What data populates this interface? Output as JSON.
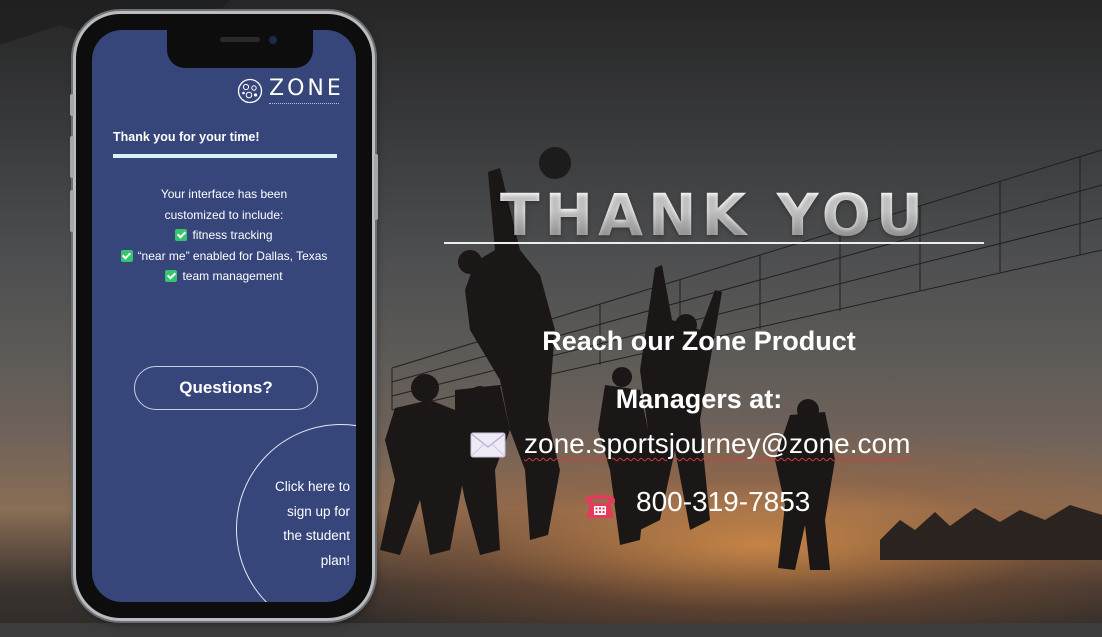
{
  "phone_screen": {
    "logo": {
      "text": "ZONE",
      "subtext": "SPORTS JOURNEY"
    },
    "thanks_heading": "Thank you for your time!",
    "intro_line1": "Your interface has been",
    "intro_line2": "customized to include:",
    "features": [
      "fitness tracking",
      "“near me” enabled for Dallas, Texas",
      "team management"
    ],
    "questions_button": "Questions?",
    "signup_cta": [
      "Click here to",
      "sign up for",
      "the student",
      "plan!"
    ]
  },
  "slide": {
    "title": "THANK YOU",
    "reach_line1": "Reach our Zone Product",
    "reach_line2": "Managers at:",
    "email": "zone.sportsjourney@zone.com",
    "phone": "800-319-7853"
  },
  "icons": {
    "check": "checkbox-checked-icon",
    "envelope": "envelope-icon",
    "telephone": "telephone-icon"
  },
  "colors": {
    "screen_bg": "#36457a",
    "check_green": "#37c46e",
    "accent_bar": "#d8f3f7",
    "telephone_red": "#e23c5c"
  }
}
